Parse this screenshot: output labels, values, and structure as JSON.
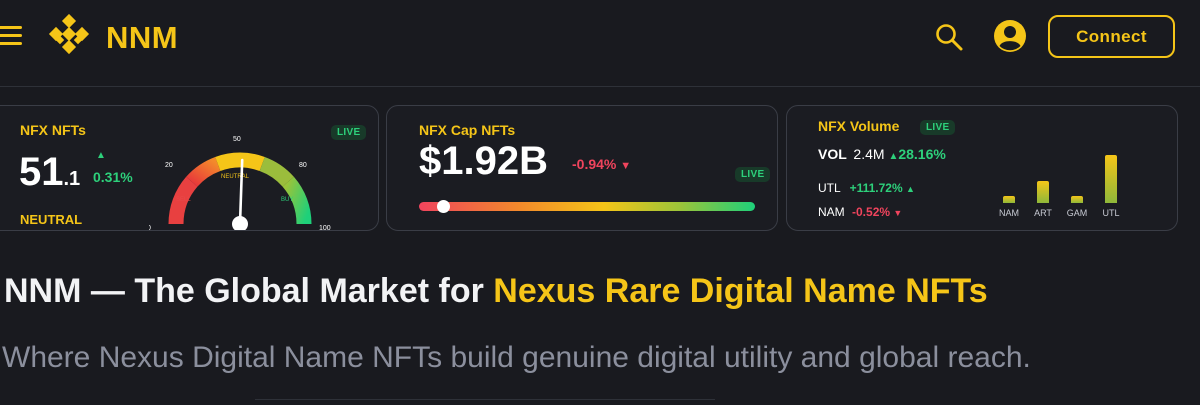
{
  "header": {
    "logo_text": "NNM",
    "connect_label": "Connect",
    "icons": {
      "menu": "hamburger-icon",
      "logo": "diamond-logo-icon",
      "search": "search-icon",
      "account": "user-circle-icon"
    },
    "accent_color": "#f5c518"
  },
  "index_card": {
    "title": "NFX NFTs",
    "value_main": "51",
    "value_decimal": ".1",
    "change": "0.31%",
    "change_direction": "up",
    "sentiment": "NEUTRAL",
    "live": "LIVE",
    "gauge": {
      "value": 51.1,
      "min": 0,
      "max": 100,
      "ticks": [
        "0",
        "20",
        "50",
        "80",
        "100"
      ],
      "zones": [
        "SELL",
        "NEUTRAL",
        "BUY"
      ]
    }
  },
  "cap_card": {
    "title": "NFX Cap NFTs",
    "value": "$1.92B",
    "change": "-0.94%",
    "change_arrow": "▼",
    "live": "LIVE",
    "slider_level": 0.07
  },
  "volume_card": {
    "title": "NFX Volume",
    "live": "LIVE",
    "vol_label": "VOL",
    "vol_value": "2.4M",
    "vol_change": "28.16%",
    "vol_arrow": "▲",
    "rows": [
      {
        "label": "UTL",
        "value": "+111.72%",
        "arrow": "▲",
        "direction": "up"
      },
      {
        "label": "NAM",
        "value": "-0.52%",
        "arrow": "▼",
        "direction": "down"
      }
    ],
    "bars": [
      {
        "label": "NAM",
        "level": 0.13
      },
      {
        "label": "ART",
        "level": 0.42
      },
      {
        "label": "GAM",
        "level": 0.13
      },
      {
        "label": "UTL",
        "level": 0.92
      }
    ]
  },
  "hero": {
    "title_plain": "NNM — The Global Market for ",
    "title_highlight": "Nexus Rare Digital Name NFTs",
    "subtitle": "Where Nexus Digital Name NFTs build genuine digital utility and global reach."
  }
}
